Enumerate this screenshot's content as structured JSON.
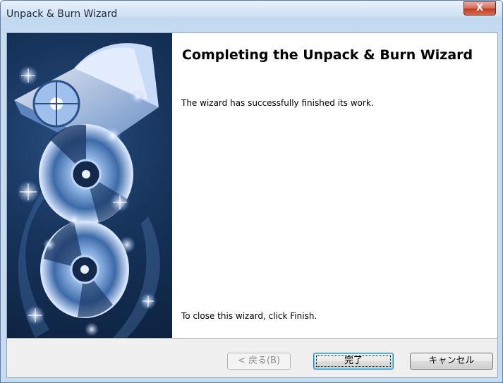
{
  "window": {
    "title": "Unpack & Burn Wizard",
    "close_label": "X"
  },
  "wizard": {
    "heading": "Completing the Unpack & Burn Wizard",
    "message": "The wizard has successfully finished its work.",
    "close_hint": "To close this wizard, click Finish."
  },
  "buttons": {
    "back_label": "< 戻る(B)",
    "finish_label": "完了",
    "cancel_label": "キャンセル"
  },
  "colors": {
    "banner": "#17345c",
    "accent": "#3c7fb1",
    "close": "#c23d24"
  },
  "icons": [
    "book-with-disc-art",
    "cd-disc",
    "sparkle"
  ]
}
